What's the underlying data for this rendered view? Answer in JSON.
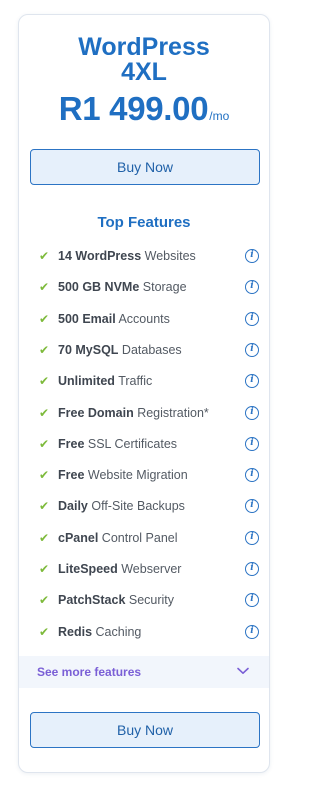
{
  "plan": {
    "name_line1": "WordPress",
    "name_line2": "4XL",
    "price": "R1 499.00",
    "unit": "/mo"
  },
  "buttons": {
    "buy_top": "Buy Now",
    "buy_bottom": "Buy Now"
  },
  "features_title": "Top Features",
  "features": [
    {
      "bold": "14 WordPress",
      "rest": " Websites"
    },
    {
      "bold": "500 GB NVMe",
      "rest": " Storage"
    },
    {
      "bold": "500 Email",
      "rest": " Accounts"
    },
    {
      "bold": "70 MySQL",
      "rest": " Databases"
    },
    {
      "bold": "Unlimited",
      "rest": " Traffic"
    },
    {
      "bold": "Free Domain",
      "rest": " Registration*"
    },
    {
      "bold": "Free",
      "rest": " SSL Certificates"
    },
    {
      "bold": "Free",
      "rest": " Website Migration"
    },
    {
      "bold": "Daily",
      "rest": " Off-Site Backups"
    },
    {
      "bold": "cPanel",
      "rest": " Control Panel"
    },
    {
      "bold": "LiteSpeed",
      "rest": " Webserver"
    },
    {
      "bold": "PatchStack",
      "rest": " Security"
    },
    {
      "bold": "Redis",
      "rest": " Caching"
    }
  ],
  "see_more": "See more features",
  "icons": {
    "check": "check-icon",
    "info": "info-icon",
    "chevron": "chevron-down-icon"
  },
  "colors": {
    "brand_blue": "#1f6fc2",
    "check_green": "#7dba3b",
    "see_more_purple": "#7a5fd6"
  }
}
